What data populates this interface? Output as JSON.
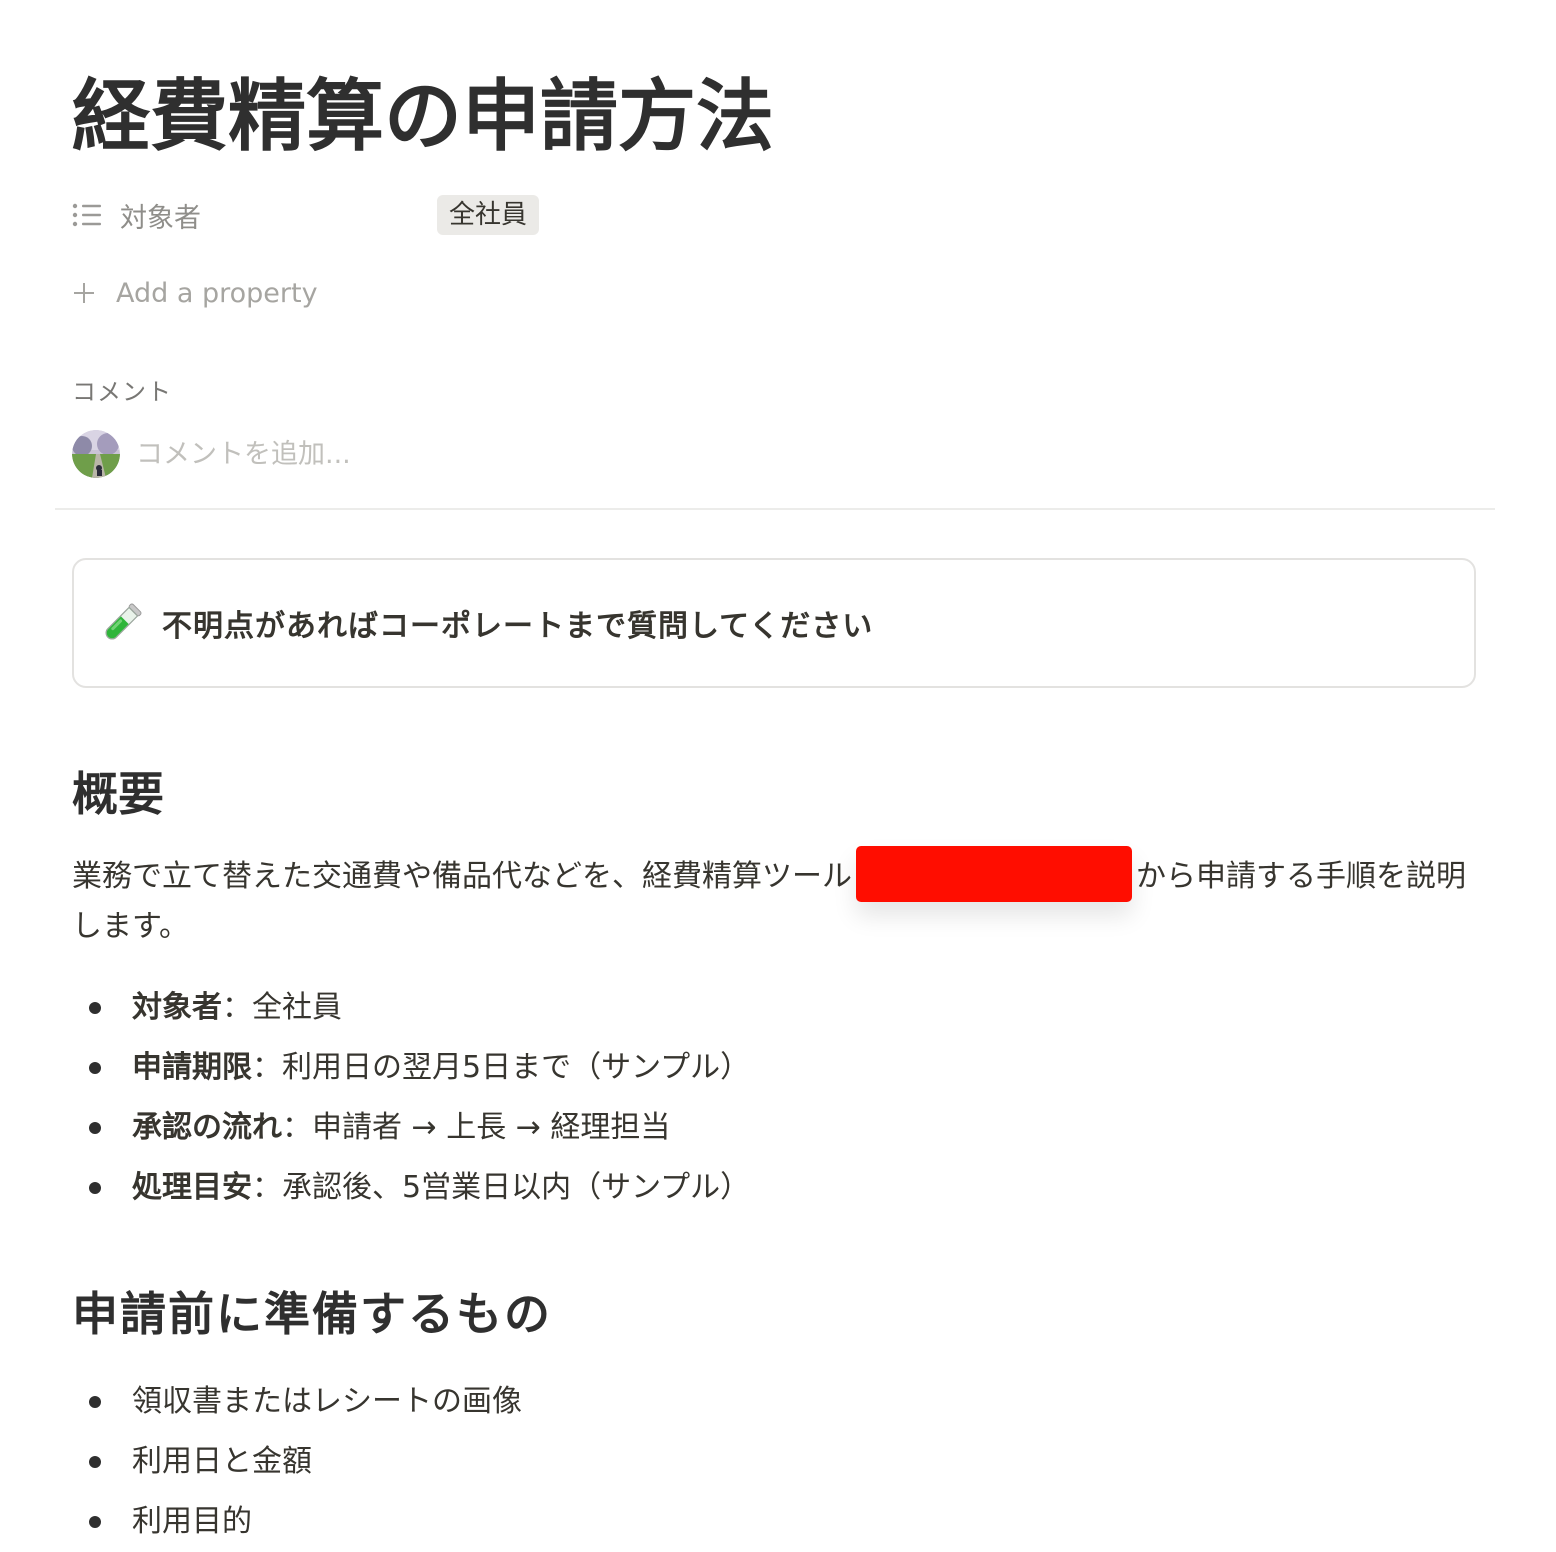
{
  "page": {
    "title": "経費精算の申請方法"
  },
  "properties": [
    {
      "icon": "list-icon",
      "label": "対象者",
      "value": "全社員"
    }
  ],
  "add_property_label": "Add a property",
  "comments": {
    "heading": "コメント",
    "input_placeholder": "コメントを追加..."
  },
  "callout": {
    "icon": "test-tube-icon",
    "text": "不明点があればコーポレートまで質問してください"
  },
  "overview": {
    "heading": "概要",
    "paragraph_before": "業務で立て替えた交通費や備品代などを、経費精算ツール",
    "paragraph_after": "から申請する手順を説明します。",
    "items": [
      {
        "label": "対象者",
        "sep": "：",
        "text": "全社員"
      },
      {
        "label": "申請期限",
        "sep": "：",
        "text": "利用日の翌月5日まで（サンプル）"
      },
      {
        "label": "承認の流れ",
        "sep": "：",
        "text": "申請者 → 上長 → 経理担当"
      },
      {
        "label": "処理目安",
        "sep": "：",
        "text": "承認後、5営業日以内（サンプル）"
      }
    ]
  },
  "preparation": {
    "heading": "申請前に準備するもの",
    "items": [
      "領収書またはレシートの画像",
      "利用日と金額",
      "利用目的"
    ]
  },
  "colors": {
    "text": "#37352f",
    "muted": "#8f8e8a",
    "tag_bg": "#ebeae7",
    "redaction": "#ff0d00",
    "divider": "#ececea"
  }
}
